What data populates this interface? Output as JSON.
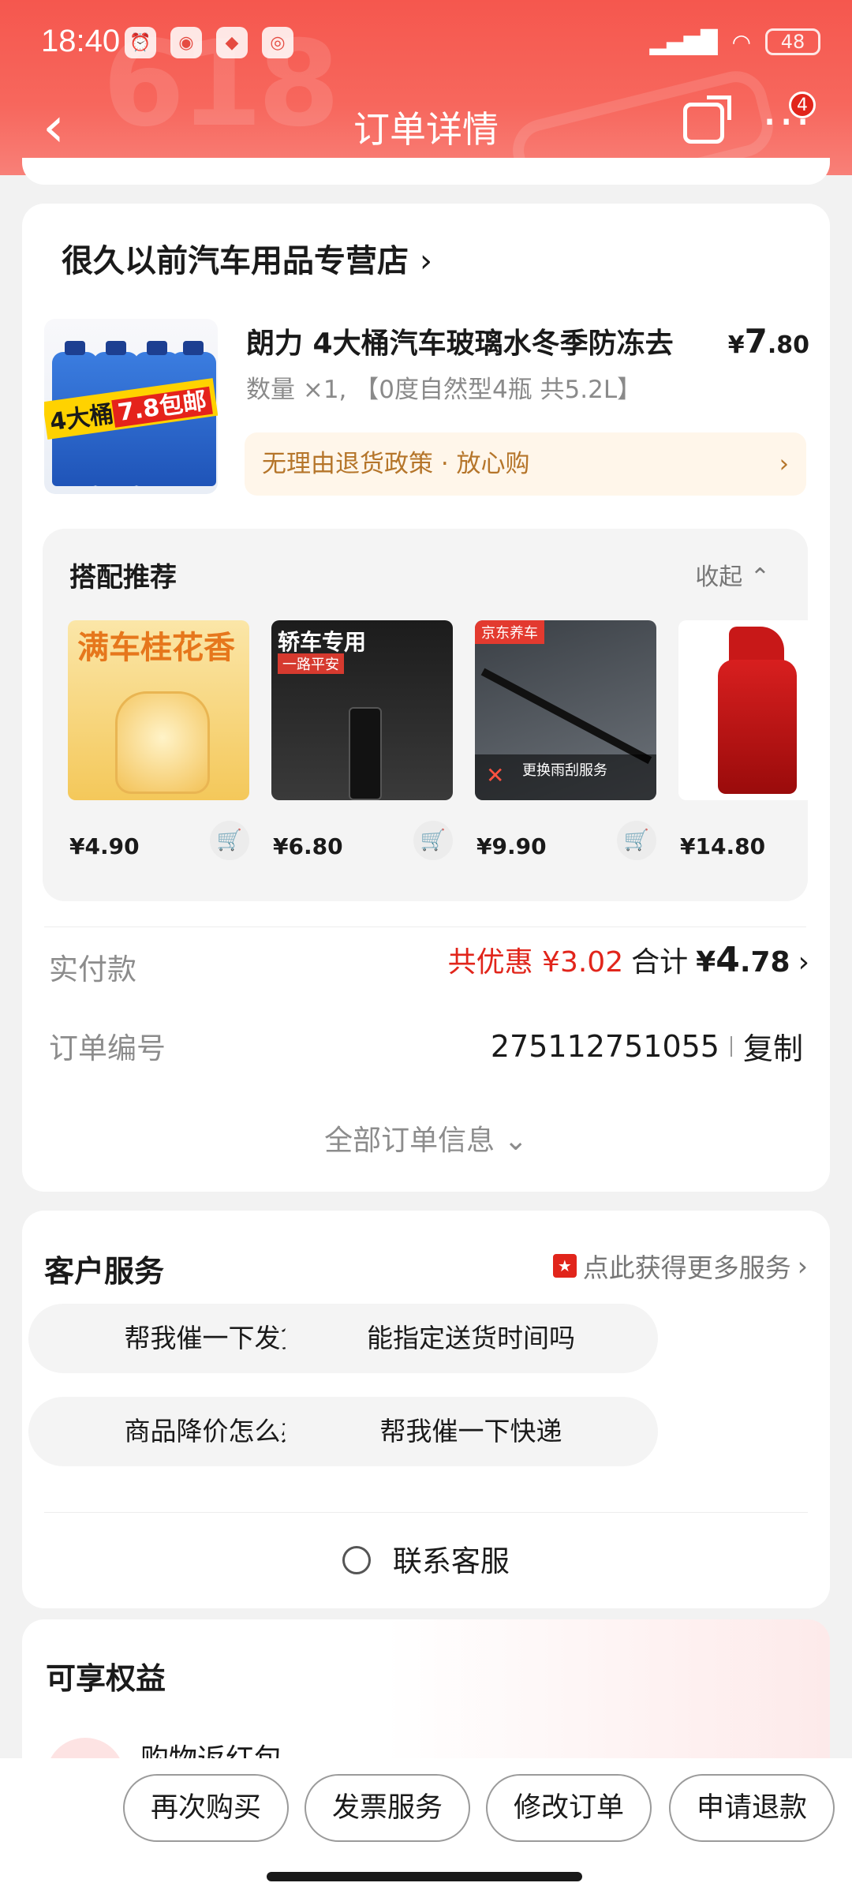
{
  "status_bar": {
    "time": "18:40",
    "battery": "48"
  },
  "nav": {
    "title": "订单详情",
    "badge_count": "4"
  },
  "store": {
    "name": "很久以前汽车用品专营店",
    "product": {
      "title": "朗力 4大桶汽车玻璃水冬季防冻去",
      "price_symbol": "¥",
      "price_int": "7",
      "price_dec": ".80",
      "spec": "数量 ×1, 【0度自然型4瓶 共5.2L】",
      "image_tag_a": "4大桶",
      "image_tag_b": "7.8包邮",
      "return_policy": "无理由退货政策 · 放心购"
    },
    "recommend": {
      "title": "搭配推荐",
      "collapse_label": "收起",
      "items": [
        {
          "price": "¥4.90",
          "image_text": "满车桂花香"
        },
        {
          "price": "¥6.80",
          "image_text": "轿车专用",
          "image_sub": "一路平安"
        },
        {
          "price": "¥9.90",
          "image_text": "京东养车",
          "image_sub": "更换雨刮服务"
        },
        {
          "price": "¥14.80"
        }
      ]
    },
    "payment": {
      "label": "实付款",
      "discount": "共优惠 ¥3.02",
      "total_label": "合计",
      "total_symbol": "¥",
      "total_int": "4",
      "total_dec": ".78"
    },
    "order": {
      "label": "订单编号",
      "number": "275112751055",
      "copy_label": "复制"
    },
    "all_info_label": "全部订单信息"
  },
  "service": {
    "title": "客户服务",
    "more_label": "点此获得更多服务",
    "quick_questions": [
      "帮我催一下发货",
      "能指定送货时间吗",
      "商品降价怎么办",
      "帮我催一下快递"
    ],
    "contact_label": "联系客服"
  },
  "benefits": {
    "title": "可享权益",
    "item": "购物返红包"
  },
  "bottom_actions": [
    "再次购买",
    "发票服务",
    "修改订单",
    "申请退款"
  ],
  "colors": {
    "accent_red": "#e1251b",
    "header_red": "#f5574e",
    "return_text": "#b5752a"
  }
}
